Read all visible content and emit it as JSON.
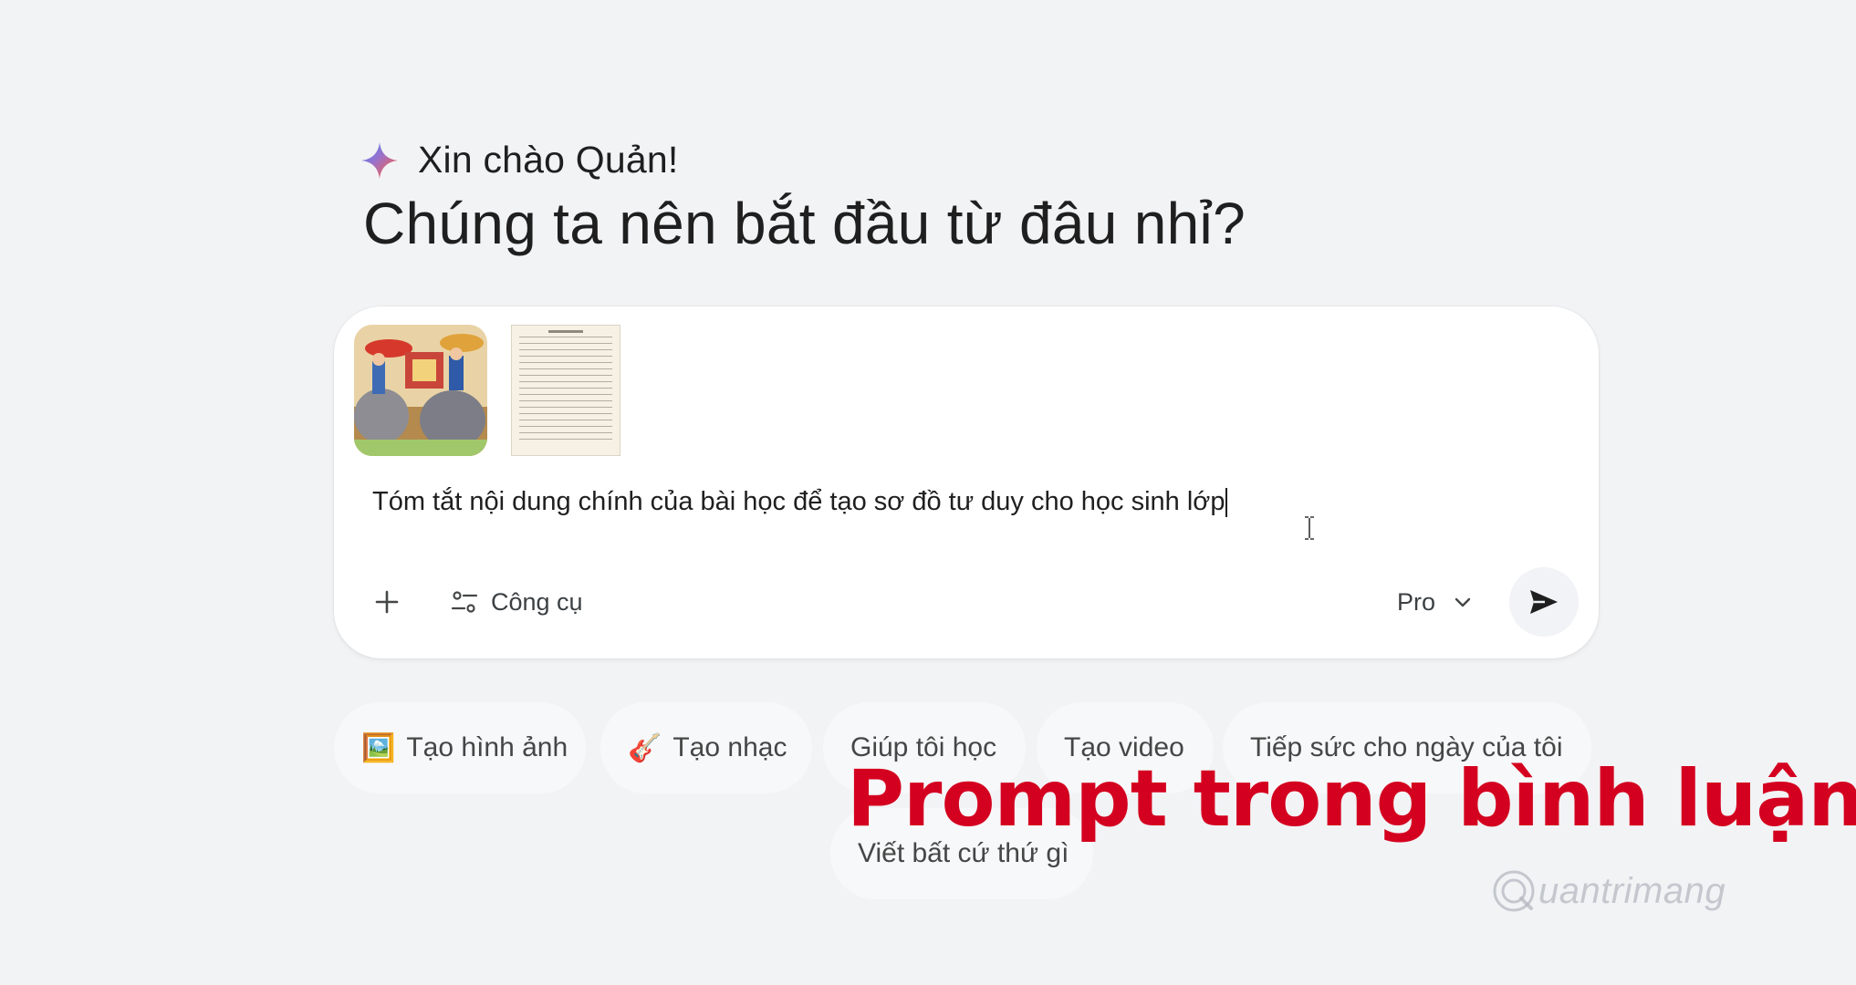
{
  "greeting": {
    "hello": "Xin chào Quản!",
    "headline": "Chúng ta nên bắt đầu từ đâu nhỉ?",
    "icon": "gemini-spark-icon"
  },
  "composer": {
    "attachments": [
      {
        "type": "image",
        "icon": "illustration-thumbnail"
      },
      {
        "type": "document",
        "icon": "document-page-thumbnail"
      }
    ],
    "prompt_value": "Tóm tắt nội dung chính của bài học để tạo sơ đồ tư duy cho học sinh lớp",
    "toolbar": {
      "plus_icon": "plus-icon",
      "tools_label": "Công cụ",
      "tools_icon": "tune-icon",
      "model_label": "Pro",
      "model_icon": "chevron-down-icon",
      "send_icon": "send-icon"
    }
  },
  "chips": [
    {
      "emoji": "🖼️",
      "label": "Tạo hình ảnh"
    },
    {
      "emoji": "🎸",
      "label": "Tạo nhạc"
    },
    {
      "emoji": "",
      "label": "Giúp tôi học"
    },
    {
      "emoji": "",
      "label": "Tạo video"
    },
    {
      "emoji": "",
      "label": "Tiếp sức cho ngày của tôi"
    },
    {
      "emoji": "",
      "label": "Viết bất cứ thứ gì"
    }
  ],
  "overlay": {
    "caption": "Prompt trong bình luận",
    "caption_color": "#d4001f",
    "watermark": "uantrimang"
  }
}
